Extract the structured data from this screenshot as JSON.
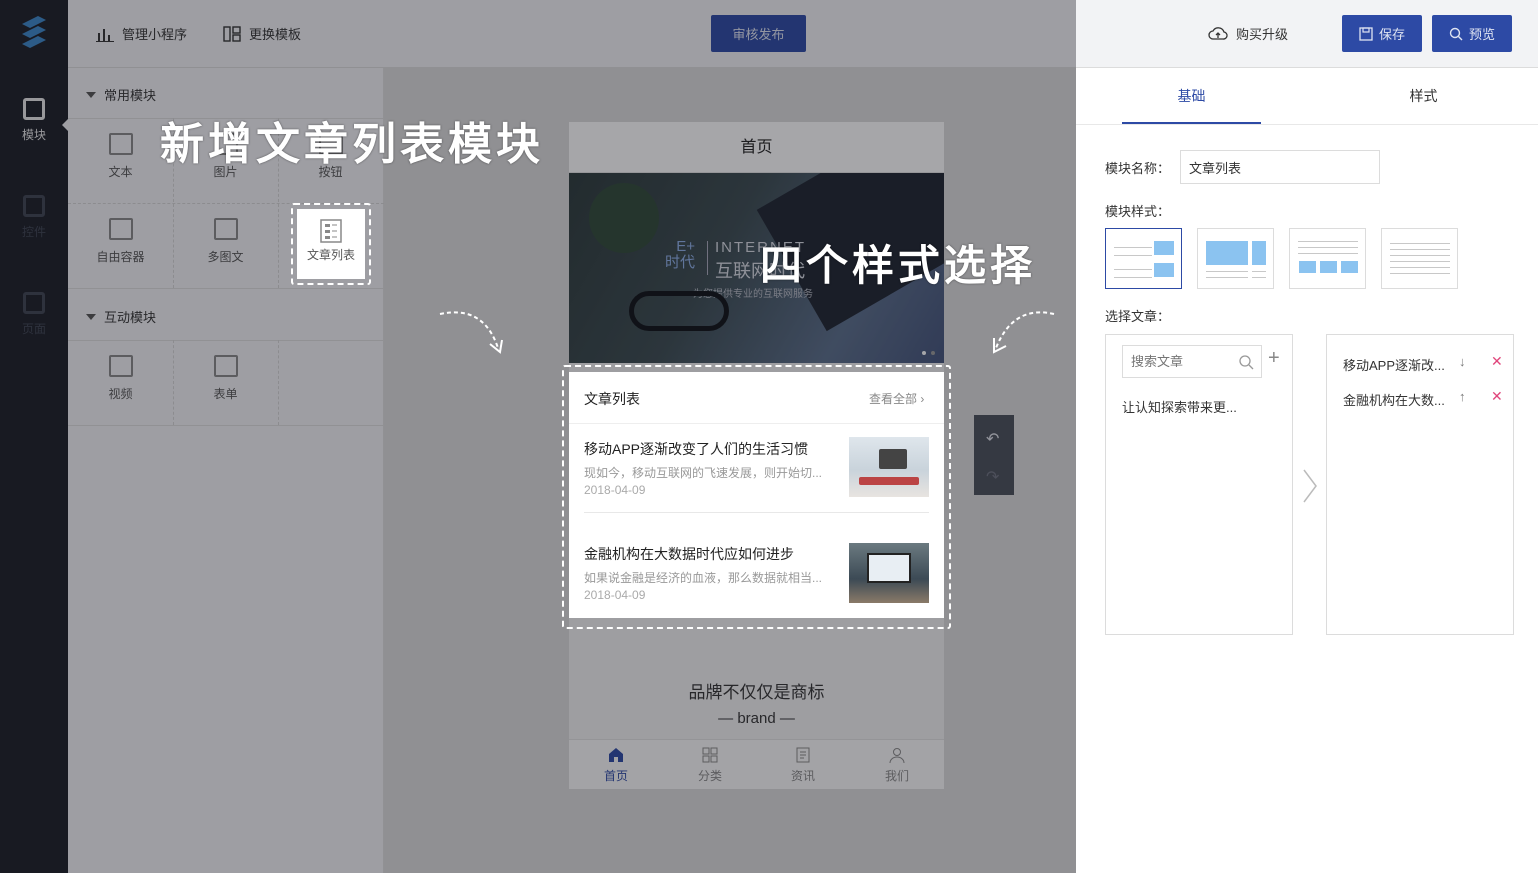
{
  "rail": {
    "items": [
      {
        "label": "模块",
        "icon": "module-icon",
        "active": true
      },
      {
        "label": "控件",
        "icon": "widget-icon",
        "active": false
      },
      {
        "label": "页面",
        "icon": "page-icon",
        "active": false
      }
    ]
  },
  "topbar": {
    "manage_label": "管理小程序",
    "template_label": "更换模板",
    "publish_label": "审核发布",
    "upgrade_label": "购买升级",
    "save_label": "保存",
    "preview_label": "预览"
  },
  "panel": {
    "common_title": "常用模块",
    "common_items": [
      "文本",
      "图片",
      "按钮",
      "自由容器",
      "多图文",
      "文章列表"
    ],
    "interact_title": "互动模块",
    "interact_items": [
      "视频",
      "表单"
    ]
  },
  "annotations": {
    "add_list": "新增文章列表模块",
    "four_styles": "四个样式选择"
  },
  "phone": {
    "page_title": "首页",
    "banner": {
      "eplus": "E+",
      "era": "时代",
      "internet": "INTERNET",
      "cn": "互联网时代",
      "tagline": "为您提供专业的互联网服务"
    },
    "list_title": "文章列表",
    "view_all": "查看全部",
    "articles": [
      {
        "title": "移动APP逐渐改变了人们的生活习惯",
        "desc": "现如今，移动互联网的飞速发展，则开始切...",
        "date": "2018-04-09"
      },
      {
        "title": "金融机构在大数据时代应如何进步",
        "desc": "如果说金融是经济的血液，那么数据就相当...",
        "date": "2018-04-09"
      }
    ],
    "brand_cn": "品牌不仅仅是商标",
    "brand_en": "brand",
    "nav": [
      "首页",
      "分类",
      "资讯",
      "我们"
    ]
  },
  "props": {
    "tab_basic": "基础",
    "tab_style": "样式",
    "name_label": "模块名称：",
    "name_value": "文章列表",
    "style_label": "模块样式：",
    "select_label": "选择文章：",
    "search_placeholder": "搜索文章",
    "candidate": "让认知探索带来更...",
    "selected": [
      {
        "title": "移动APP逐渐改...",
        "arrow": "↓"
      },
      {
        "title": "金融机构在大数...",
        "arrow": "↑"
      }
    ]
  },
  "colors": {
    "accent": "#2d4aa5",
    "rail": "#1a1e26",
    "style_blue": "#8bc3f0",
    "delete": "#e0457b"
  }
}
